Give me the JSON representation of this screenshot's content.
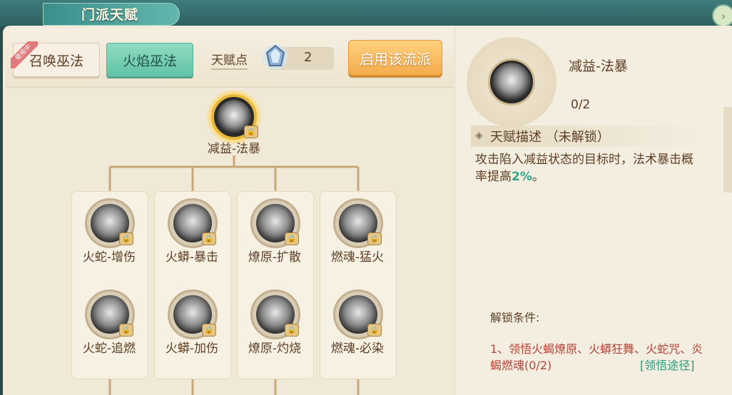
{
  "window": {
    "title": "门派天赋",
    "close_icon": "chevron-icon"
  },
  "tabs": {
    "summon_label": "召唤巫法",
    "summon_badge": "使用中",
    "fire_label": "火焰巫法"
  },
  "points": {
    "label": "天赋点",
    "value": "2",
    "icon": "crystal-icon"
  },
  "enable_button": "启用该流派",
  "tree": {
    "root": {
      "label": "减益-法暴"
    },
    "columns": [
      {
        "top": "火蛇-增伤",
        "bottom": "火蛇-追燃"
      },
      {
        "top": "火蟒-暴击",
        "bottom": "火蟒-加伤"
      },
      {
        "top": "燎原-扩散",
        "bottom": "燎原-灼烧"
      },
      {
        "top": "燃魂-猛火",
        "bottom": "燃魂-必染"
      }
    ]
  },
  "detail": {
    "name": "减益-法暴",
    "progress": "0/2",
    "desc_title": "天赋描述 （未解锁）",
    "desc_text_1": "攻击陷入减益状态的目标时，法术暴击概率提高",
    "desc_highlight": "2%",
    "desc_text_2": "。",
    "cond_title": "解锁条件:",
    "cond_text": "1、领悟火蝎燎原、火蟒狂舞、火蛇咒、炎蝎燃魂(0/2)",
    "cond_link": "[领悟途径]"
  },
  "colors": {
    "accent_teal": "#62c3a6",
    "accent_orange": "#f4ab4c",
    "highlight": "#2fa68a",
    "condition": "#b4433a"
  }
}
